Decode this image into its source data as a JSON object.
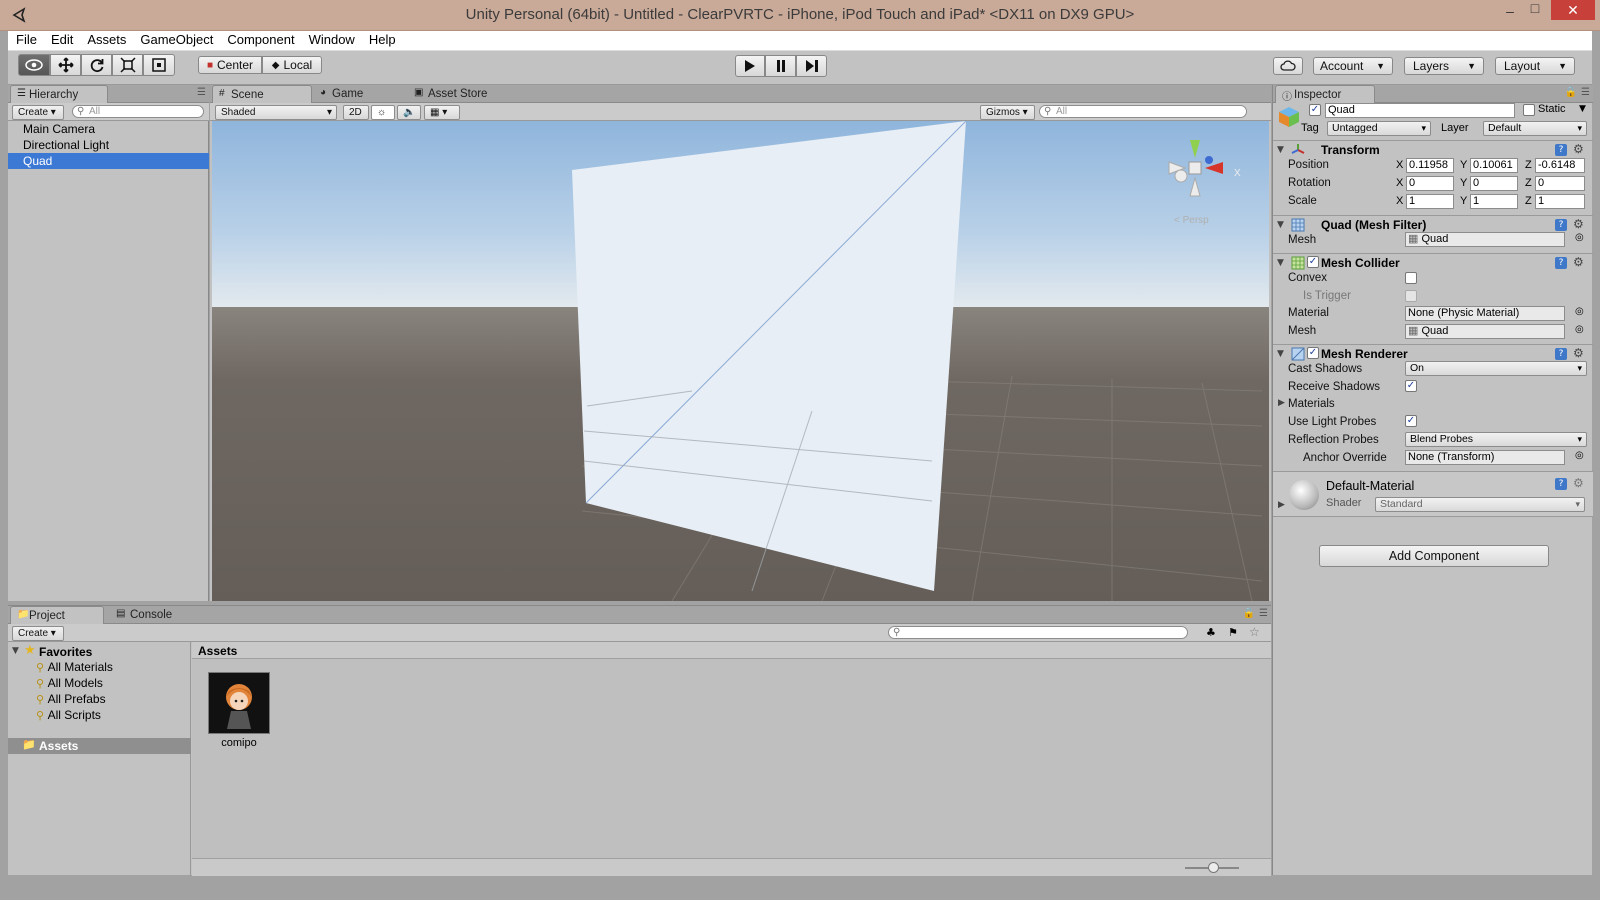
{
  "window": {
    "title": "Unity Personal (64bit) - Untitled - ClearPVRTC - iPhone, iPod Touch and iPad* <DX11 on DX9 GPU>",
    "controls": [
      "–",
      "□",
      "✕"
    ]
  },
  "menu": [
    "File",
    "Edit",
    "Assets",
    "GameObject",
    "Component",
    "Window",
    "Help"
  ],
  "toolbar": {
    "pivot_label": "Center",
    "space_label": "Local",
    "account_label": "Account",
    "layers_label": "Layers",
    "layout_label": "Layout"
  },
  "hierarchy": {
    "tab": "Hierarchy",
    "create": "Create",
    "search_placeholder": "All",
    "items": [
      "Main Camera",
      "Directional Light",
      "Quad"
    ],
    "selected_index": 2
  },
  "scene": {
    "tabs": [
      "Scene",
      "Game",
      "Asset Store"
    ],
    "shading": "Shaded",
    "mode_2d": "2D",
    "gizmos": "Gizmos",
    "search_placeholder": "All",
    "gizmo_label": "< Persp",
    "sky_color": "#a5c6e6",
    "ground_color": "#6a635d",
    "quad_color": "#e6edf4"
  },
  "inspector": {
    "tab": "Inspector",
    "object_name": "Quad",
    "static_label": "Static",
    "tag_label": "Tag",
    "tag_value": "Untagged",
    "layer_label": "Layer",
    "layer_value": "Default",
    "transform": {
      "title": "Transform",
      "position_label": "Position",
      "rotation_label": "Rotation",
      "scale_label": "Scale",
      "position": {
        "x": "0.11958",
        "y": "0.10061",
        "z": "-0.6148"
      },
      "rotation": {
        "x": "0",
        "y": "0",
        "z": "0"
      },
      "scale": {
        "x": "1",
        "y": "1",
        "z": "1"
      }
    },
    "mesh_filter": {
      "title": "Quad (Mesh Filter)",
      "mesh_label": "Mesh",
      "mesh_value": "Quad"
    },
    "mesh_collider": {
      "title": "Mesh Collider",
      "convex_label": "Convex",
      "trigger_label": "Is Trigger",
      "material_label": "Material",
      "material_value": "None (Physic Material)",
      "mesh_label": "Mesh",
      "mesh_value": "Quad"
    },
    "mesh_renderer": {
      "title": "Mesh Renderer",
      "cast_shadows_label": "Cast Shadows",
      "cast_shadows_value": "On",
      "receive_shadows_label": "Receive Shadows",
      "materials_label": "Materials",
      "light_probes_label": "Use Light Probes",
      "reflection_label": "Reflection Probes",
      "reflection_value": "Blend Probes",
      "anchor_label": "Anchor Override",
      "anchor_value": "None (Transform)"
    },
    "material": {
      "name": "Default-Material",
      "shader_label": "Shader",
      "shader_value": "Standard"
    },
    "add_component": "Add Component"
  },
  "project": {
    "tabs": [
      "Project",
      "Console"
    ],
    "create": "Create",
    "favorites_label": "Favorites",
    "favorites": [
      "All Materials",
      "All Models",
      "All Prefabs",
      "All Scripts"
    ],
    "assets_folder": "Assets",
    "breadcrumb": "Assets",
    "asset_items": [
      {
        "name": "comipo"
      }
    ]
  },
  "axes": {
    "x": "X",
    "y": "Y",
    "z": "Z"
  }
}
